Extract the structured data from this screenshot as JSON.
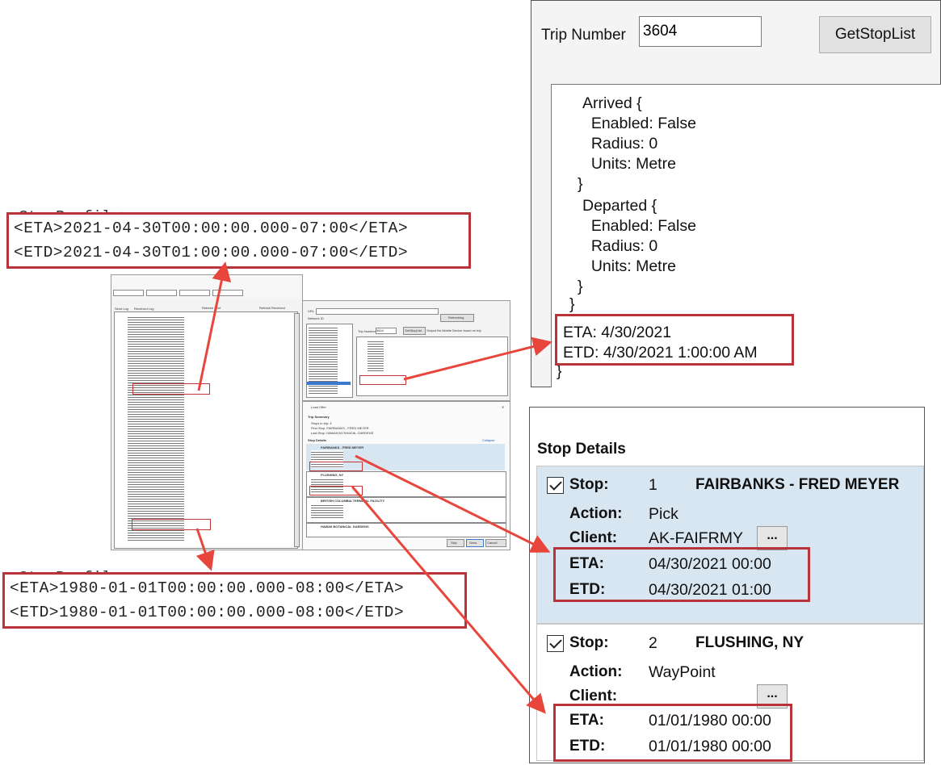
{
  "xml_top": {
    "eta_line": "<ETA>2021-04-30T00:00:00.000-07:00</ETA>",
    "etd_line": "<ETD>2021-04-30T01:00:00.000-07:00</ETD>"
  },
  "xml_bottom": {
    "eta_line": "<ETA>1980-01-01T00:00:00.000-08:00</ETA>",
    "etd_line": "<ETD>1980-01-01T00:00:00.000-08:00</ETD>"
  },
  "trip_panel": {
    "trip_number_label": "Trip Number",
    "trip_number_value": "3604",
    "get_stop_list_label": "GetStopList",
    "output_lines": [
      "Arrived {",
      "  Enabled: False",
      "  Radius: 0",
      "  Units: Metre",
      "}",
      "Departed {",
      "  Enabled: False",
      "  Radius: 0",
      "  Units: Metre",
      "}",
      "}",
      "ETA: 4/30/2021",
      "ETD: 4/30/2021 1:00:00 AM",
      "}"
    ]
  },
  "stop_details": {
    "title": "Stop Details",
    "stops": [
      {
        "stop_label": "Stop:",
        "number": "1",
        "name": "FAIRBANKS - FRED MEYER",
        "action_label": "Action:",
        "action": "Pick",
        "client_label": "Client:",
        "client": "AK-FAIFRMY",
        "ellipsis": "...",
        "eta_label": "ETA:",
        "eta": "04/30/2021 00:00",
        "etd_label": "ETD:",
        "etd": "04/30/2021 01:00"
      },
      {
        "stop_label": "Stop:",
        "number": "2",
        "name": "FLUSHING, NY",
        "action_label": "Action:",
        "action": "WayPoint",
        "client_label": "Client:",
        "client": "",
        "ellipsis": "...",
        "eta_label": "ETA:",
        "eta": "01/01/1980 00:00",
        "etd_label": "ETD:",
        "etd": "01/01/1980 00:00"
      }
    ]
  },
  "mini_screenshot": {
    "log_tabs": [
      "Send Log",
      "Received Log"
    ],
    "checks": [
      "Refresh Sent",
      "Refresh Received"
    ],
    "url_label": "URL",
    "network_label": "Network ID",
    "refresh_label": "Refreshing",
    "trip_number_label": "Trip Number",
    "trip_number_value": "3604",
    "get_stop_list": "GetStopList",
    "output_label": "Output",
    "output_text": "No Mobile Device found on trip",
    "load_offer_title": "Load Offer",
    "trip_summary": "Trip Summary",
    "summary_lines": [
      "Stops in trip: 4",
      "First Stop: FAIRBANKS - FRED MEYER",
      "Last Stop: HAWAII BOTANICAL GARDENS"
    ],
    "stop_details": "Stop Details",
    "collapse": "Collapse",
    "mini_stops": [
      "FAIRBANKS - FRED MEYER",
      "FLUSHING, NY",
      "BRITISH COLUMBIA TERMINAL FACILITY",
      "HAWAII BOTANICAL GARDENS"
    ],
    "buttons": [
      "Skip",
      "Send",
      "Cancel"
    ]
  },
  "colors": {
    "highlight_red": "#b8333a",
    "arrow_red": "#e8463c",
    "selected_row": "#d8e6f2"
  }
}
